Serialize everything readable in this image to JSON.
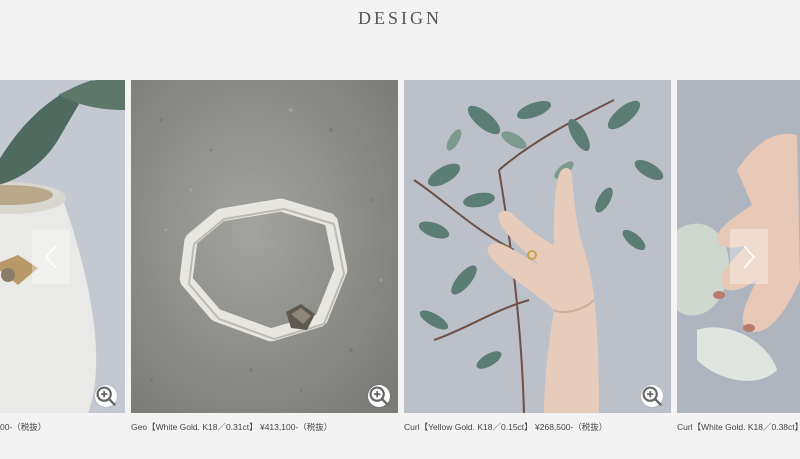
{
  "section": {
    "title": "DESIGN"
  },
  "carousel": {
    "prev_icon": "chevron-left-icon",
    "next_icon": "chevron-right-icon",
    "items": [
      {
        "caption": "00-（税抜）",
        "zoom_icon": "zoom-in-icon"
      },
      {
        "caption": "Geo【White Gold. K18／0.31ct】 ¥413,100-（税抜）",
        "zoom_icon": "zoom-in-icon"
      },
      {
        "caption": "Curl【Yellow Gold. K18／0.15ct】 ¥268,500-（税抜）",
        "zoom_icon": "zoom-in-icon"
      },
      {
        "caption": "Curl【White Gold. K18／0.38ct】 ¥3",
        "zoom_icon": "zoom-in-icon"
      }
    ]
  },
  "colors": {
    "background": "#f3f3f3",
    "text": "#444444",
    "title": "#555555"
  }
}
